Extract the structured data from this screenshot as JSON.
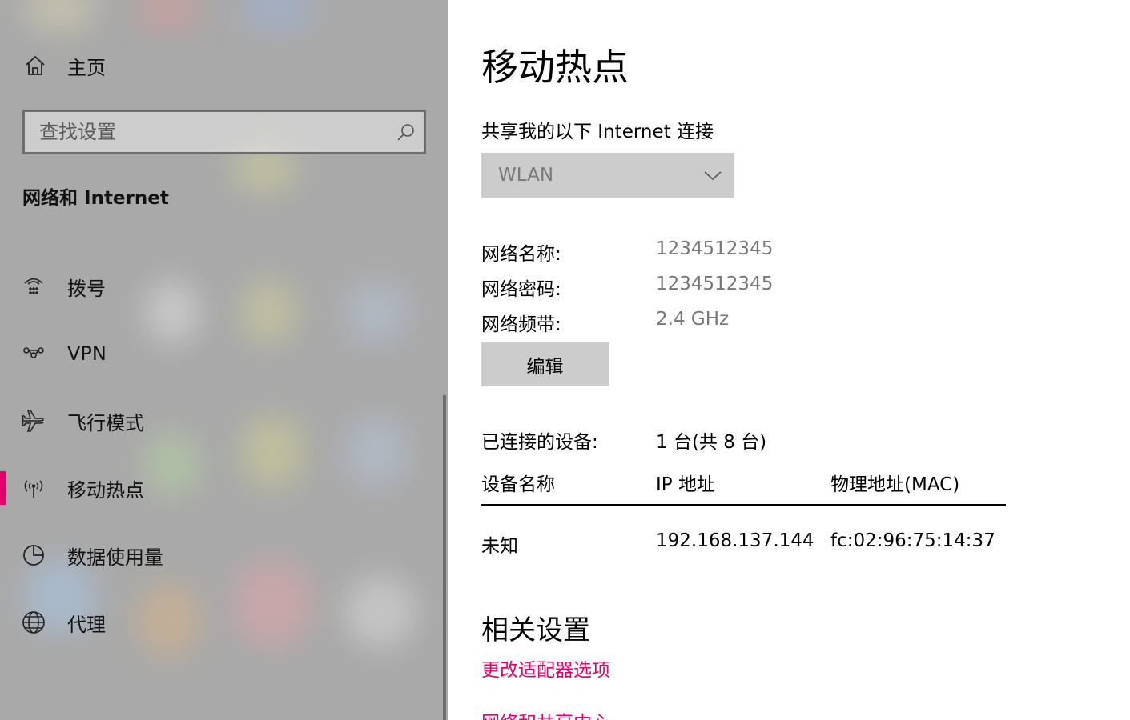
{
  "sidebar": {
    "home_label": "主页",
    "search_placeholder": "查找设置",
    "section_title": "网络和 Internet",
    "items": [
      {
        "label": "拨号",
        "icon": "dialup-icon"
      },
      {
        "label": "VPN",
        "icon": "vpn-icon"
      },
      {
        "label": "飞行模式",
        "icon": "airplane-icon"
      },
      {
        "label": "移动热点",
        "icon": "mobile-hotspot-icon",
        "selected": true
      },
      {
        "label": "数据使用量",
        "icon": "data-usage-icon"
      },
      {
        "label": "代理",
        "icon": "globe-icon"
      }
    ]
  },
  "main": {
    "title": "移动热点",
    "share_label": "共享我的以下 Internet 连接",
    "share_dropdown_value": "WLAN",
    "network": {
      "name_label": "网络名称:",
      "name_value": "1234512345",
      "password_label": "网络密码:",
      "password_value": "1234512345",
      "band_label": "网络频带:",
      "band_value": "2.4 GHz"
    },
    "edit_button": "编辑",
    "connected_label": "已连接的设备:",
    "connected_value": "1 台(共 8 台)",
    "table": {
      "headers": [
        "设备名称",
        "IP 地址",
        "物理地址(MAC)"
      ],
      "rows": [
        [
          "未知",
          "192.168.137.144",
          "fc:02:96:75:14:37"
        ]
      ]
    },
    "related_title": "相关设置",
    "links": [
      "更改适配器选项",
      "网络和共享中心"
    ]
  },
  "colors": {
    "accent": "#e3006a",
    "sidebar_bg": "#a9a9a9",
    "button_bg": "#cccccc"
  }
}
